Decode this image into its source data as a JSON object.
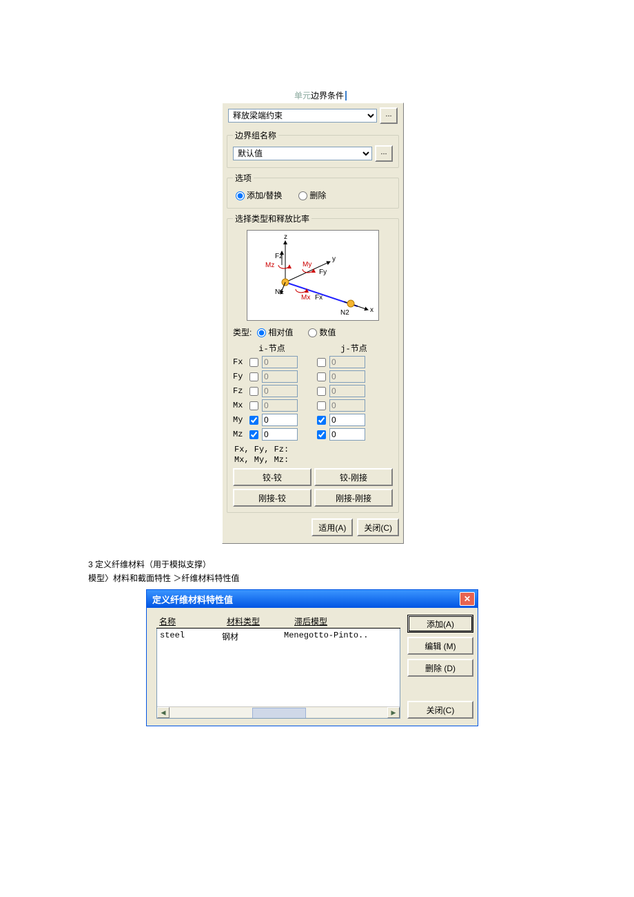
{
  "top_caption": {
    "grey": "单元",
    "black": "边界条件"
  },
  "panel": {
    "main_combo": "释放梁端约束",
    "dots": "...",
    "group_section": {
      "legend": "边界组名称",
      "combo": "默认值"
    },
    "option_section": {
      "legend": "选项",
      "radio_add": "添加/替换",
      "radio_del": "删除"
    },
    "select_section": {
      "legend": "选择类型和释放比率",
      "type_label": "类型:",
      "radio_rel": "相对值",
      "radio_val": "数值",
      "i_legend": "i-节点",
      "j_legend": "j-节点",
      "dofs": [
        "Fx",
        "Fy",
        "Fz",
        "Mx",
        "My",
        "Mz"
      ],
      "checked": {
        "Fx": false,
        "Fy": false,
        "Fz": false,
        "Mx": false,
        "My": true,
        "Mz": true
      },
      "zero": "0",
      "note1": "Fx, Fy, Fz:",
      "note2": "Mx, My, Mz:",
      "btn_hh": "铰-铰",
      "btn_hr": "铰-刚接",
      "btn_rh": "刚接-铰",
      "btn_rr": "刚接-刚接"
    },
    "apply": "适用(A)",
    "close": "关闭(C)"
  },
  "text_section": {
    "line1": "3 定义纤维材料（用于模拟支撑）",
    "line2": "模型〉材料和截面特性 ＞纤维材料特性值"
  },
  "dialog": {
    "title": "定义纤维材料特性值",
    "headers": {
      "name": "名称",
      "type": "材料类型",
      "model": "滞后模型"
    },
    "row": {
      "name": "steel",
      "type": "钢材",
      "model": "Menegotto-Pinto.."
    },
    "btn_add": "添加(A)",
    "btn_edit": "编辑 (M)",
    "btn_del": "删除 (D)",
    "btn_close": "关闭(C)"
  },
  "diagram": {
    "z": "z",
    "y": "y",
    "x": "x",
    "Fz": "Fz",
    "Mz": "Mz",
    "My": "My",
    "Fy": "Fy",
    "Mx": "Mx",
    "Fx": "Fx",
    "N1": "N1",
    "N2": "N2"
  }
}
